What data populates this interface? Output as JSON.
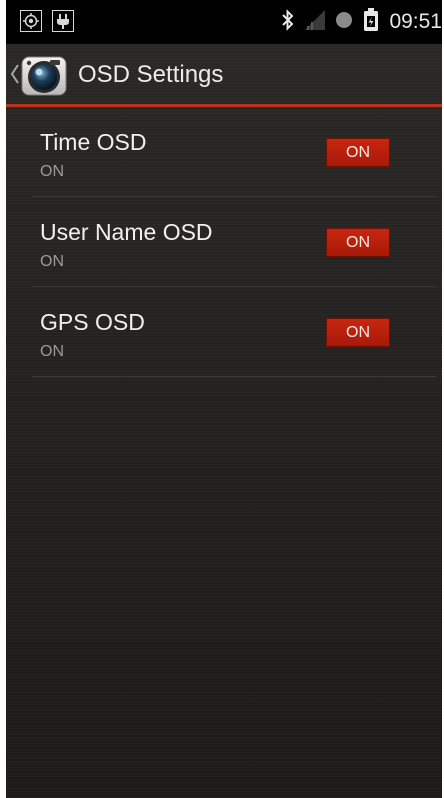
{
  "status_bar": {
    "time": "09:51",
    "icons": [
      "location-target-icon",
      "usb-plug-icon",
      "bluetooth-icon",
      "signal-icon",
      "sync-dot-icon",
      "battery-icon"
    ]
  },
  "action_bar": {
    "title": "OSD Settings",
    "icons": [
      "back-chevron-icon",
      "camera-app-icon"
    ]
  },
  "settings": [
    {
      "title": "Time OSD",
      "summary": "ON",
      "toggle": "ON"
    },
    {
      "title": "User Name OSD",
      "summary": "ON",
      "toggle": "ON"
    },
    {
      "title": "GPS OSD",
      "summary": "ON",
      "toggle": "ON"
    }
  ],
  "colors": {
    "accent": "#b8321e",
    "toggle_on": "#c8260f",
    "background": "#222120",
    "status_bar": "#000000"
  }
}
